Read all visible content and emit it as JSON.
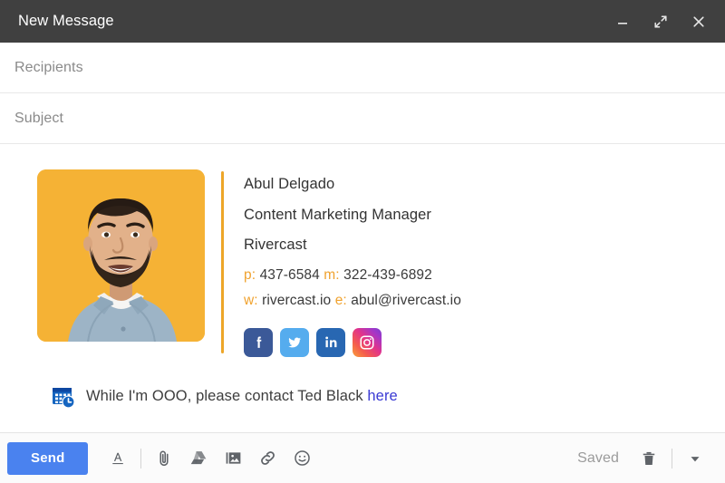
{
  "window": {
    "title": "New Message",
    "controls": [
      {
        "name": "minimize",
        "icon": "minimize-icon"
      },
      {
        "name": "expand",
        "icon": "expand-icon"
      },
      {
        "name": "close",
        "icon": "close-icon"
      }
    ]
  },
  "fields": {
    "recipients": {
      "value": "",
      "placeholder": "Recipients"
    },
    "subject": {
      "value": "",
      "placeholder": "Subject"
    }
  },
  "signature": {
    "photo_alt": "portrait-photo",
    "photo_background": "#f5b235",
    "divider_color": "#eda629",
    "name": "Abul Delgado",
    "title": "Content Marketing Manager",
    "company": "Rivercast",
    "contact": {
      "phone_label": "p:",
      "phone_value": "437-6584",
      "mobile_label": "m:",
      "mobile_value": "322-439-6892",
      "web_label": "w:",
      "web_value": "rivercast.io",
      "email_label": "e:",
      "email_value": "abul@rivercast.io",
      "label_color": "#f0a22e"
    },
    "socials": [
      {
        "name": "facebook",
        "label": "Facebook",
        "color": "#3b5998"
      },
      {
        "name": "twitter",
        "label": "Twitter",
        "color": "#55acee"
      },
      {
        "name": "linkedin",
        "label": "LinkedIn",
        "color": "#2867b2"
      },
      {
        "name": "instagram",
        "label": "Instagram",
        "color": "#e2348a"
      }
    ]
  },
  "ooo": {
    "icon": "calendar-clock-icon",
    "text_before": "While I'm OOO, please contact Ted Black",
    "link_text": "here",
    "link_color": "#3b3bd4"
  },
  "toolbar": {
    "send_label": "Send",
    "send_color": "#4a82ef",
    "icons": [
      {
        "name": "format-text-icon",
        "label": "Formatting options"
      },
      {
        "name": "attach-file-icon",
        "label": "Attach files"
      },
      {
        "name": "google-drive-icon",
        "label": "Insert files using Drive"
      },
      {
        "name": "insert-photo-icon",
        "label": "Insert photo"
      },
      {
        "name": "insert-link-icon",
        "label": "Insert link"
      },
      {
        "name": "insert-emoji-icon",
        "label": "Insert emoji"
      }
    ],
    "status_label": "Saved",
    "trash_icon": "trash-icon",
    "more_icon": "more-options-icon"
  }
}
